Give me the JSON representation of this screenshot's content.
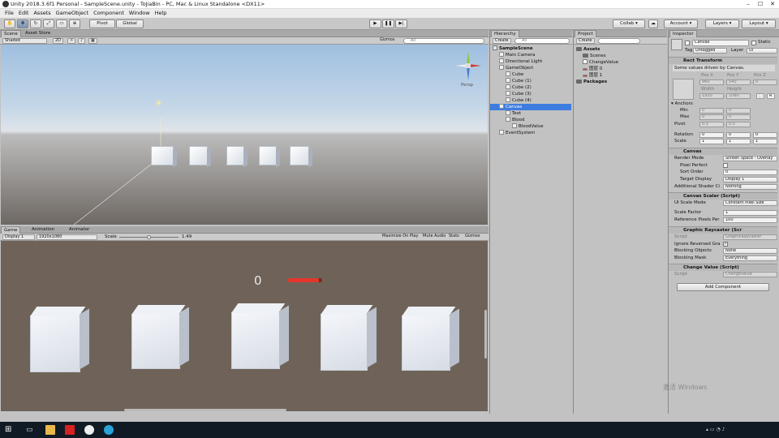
{
  "window": {
    "title": "Unity 2018.3.6f1 Personal - SampleScene.unity - ToJiaBin - PC, Mac & Linux Standalone <DX11>"
  },
  "menu": [
    "File",
    "Edit",
    "Assets",
    "GameObject",
    "Component",
    "Window",
    "Help"
  ],
  "toolbar": {
    "pivot": "Pivot",
    "global": "Global",
    "collab": "Collab",
    "account": "Account",
    "layers": "Layers",
    "layout": "Layout"
  },
  "scene": {
    "tabs": [
      "Scene",
      "Asset Store"
    ],
    "shading": "Shaded",
    "mode2d": "2D",
    "gizmos": "Gizmos",
    "search": "All",
    "persp": "Persp",
    "axes": {
      "x": "x",
      "y": "y",
      "z": "z"
    }
  },
  "game": {
    "tabs": [
      "Game",
      "Animation",
      "Animator"
    ],
    "display": "Display 1",
    "resolution": "1920x1080",
    "scale_label": "Scale",
    "scale_value": "1.49",
    "buttons": [
      "Maximize On Play",
      "Mute Audio",
      "Stats",
      "Gizmos"
    ],
    "score_text": "0",
    "blood_value": 0.9
  },
  "hierarchy": {
    "tab": "Hierarchy",
    "create": "Create",
    "search": "All",
    "items": [
      {
        "label": "SampleScene",
        "depth": 0,
        "bold": true,
        "icon": "unity-scene-icon"
      },
      {
        "label": "Main Camera",
        "depth": 1,
        "icon": "gameobject-icon"
      },
      {
        "label": "Directional Light",
        "depth": 1,
        "icon": "gameobject-icon"
      },
      {
        "label": "GameObject",
        "depth": 1,
        "icon": "gameobject-icon"
      },
      {
        "label": "Cube",
        "depth": 2,
        "icon": "gameobject-icon"
      },
      {
        "label": "Cube (1)",
        "depth": 2,
        "icon": "gameobject-icon"
      },
      {
        "label": "Cube (2)",
        "depth": 2,
        "icon": "gameobject-icon"
      },
      {
        "label": "Cube (3)",
        "depth": 2,
        "icon": "gameobject-icon"
      },
      {
        "label": "Cube (4)",
        "depth": 2,
        "icon": "gameobject-icon"
      },
      {
        "label": "Canvas",
        "depth": 1,
        "selected": true,
        "icon": "gameobject-icon"
      },
      {
        "label": "Text",
        "depth": 2,
        "icon": "gameobject-icon"
      },
      {
        "label": "Blood",
        "depth": 2,
        "icon": "gameobject-icon"
      },
      {
        "label": "BloodValue",
        "depth": 3,
        "icon": "gameobject-icon"
      },
      {
        "label": "EventSystem",
        "depth": 1,
        "icon": "gameobject-icon"
      }
    ]
  },
  "project": {
    "tab": "Project",
    "create": "Create",
    "items": [
      {
        "label": "Assets",
        "depth": 0,
        "bold": true,
        "icon": "folder-icon"
      },
      {
        "label": "Scenes",
        "depth": 1,
        "icon": "folder-icon"
      },
      {
        "label": "ChangeValue",
        "depth": 1,
        "icon": "script-icon"
      },
      {
        "label": "图层 0",
        "depth": 1,
        "icon": "sprite-icon"
      },
      {
        "label": "图层 1",
        "depth": 1,
        "icon": "sprite-icon"
      },
      {
        "label": "Packages",
        "depth": 0,
        "bold": true,
        "icon": "folder-icon"
      }
    ]
  },
  "inspector": {
    "tab": "Inspector",
    "object_name": "Canvas",
    "static": "Static",
    "tag_label": "Tag",
    "tag": "Untagged",
    "layer_label": "Layer",
    "layer": "UI",
    "rect": {
      "title": "Rect Transform",
      "note": "Some values driven by Canvas.",
      "labels": [
        "Pos X",
        "Pos Y",
        "Pos Z"
      ],
      "values": [
        "960",
        "540",
        "0"
      ],
      "wh_labels": [
        "Width",
        "Height"
      ],
      "wh": [
        "1920",
        "1080"
      ],
      "anchors": "Anchors",
      "min": "Min",
      "max": "Max",
      "pivot": "Pivot",
      "min_v": [
        "0",
        "0"
      ],
      "max_v": [
        "0",
        "0"
      ],
      "pivot_v": [
        "0.5",
        "0.5"
      ],
      "rotation": "Rotation",
      "rot_v": [
        "0",
        "0",
        "0"
      ],
      "scale": "Scale",
      "scale_v": [
        "1",
        "1",
        "1"
      ],
      "r_label": "R"
    },
    "canvas": {
      "title": "Canvas",
      "render_mode_label": "Render Mode",
      "render_mode": "Screen Space - Overlay",
      "pixel_perfect": "Pixel Perfect",
      "sort_order_label": "Sort Order",
      "sort_order": "0",
      "target_display_label": "Target Display",
      "target_display": "Display 1",
      "shader_label": "Additional Shader Cl",
      "shader": "Nothing"
    },
    "scaler": {
      "title": "Canvas Scaler (Script)",
      "mode_label": "UI Scale Mode",
      "mode": "Constant Pixel Size",
      "factor_label": "Scale Factor",
      "factor": "1",
      "ref_label": "Reference Pixels Per",
      "ref": "100"
    },
    "raycaster": {
      "title": "Graphic Raycaster (Scr",
      "script_label": "Script",
      "script": "GraphicRaycaster",
      "ignore_label": "Ignore Reversed Gra",
      "blocking_label": "Blocking Objects",
      "blocking": "None",
      "mask_label": "Blocking Mask",
      "mask": "Everything"
    },
    "change": {
      "title": "Change Value (Script)",
      "script_label": "Script",
      "script": "ChangeValue"
    },
    "add_component": "Add Component"
  },
  "watermark": "激活 Windows"
}
